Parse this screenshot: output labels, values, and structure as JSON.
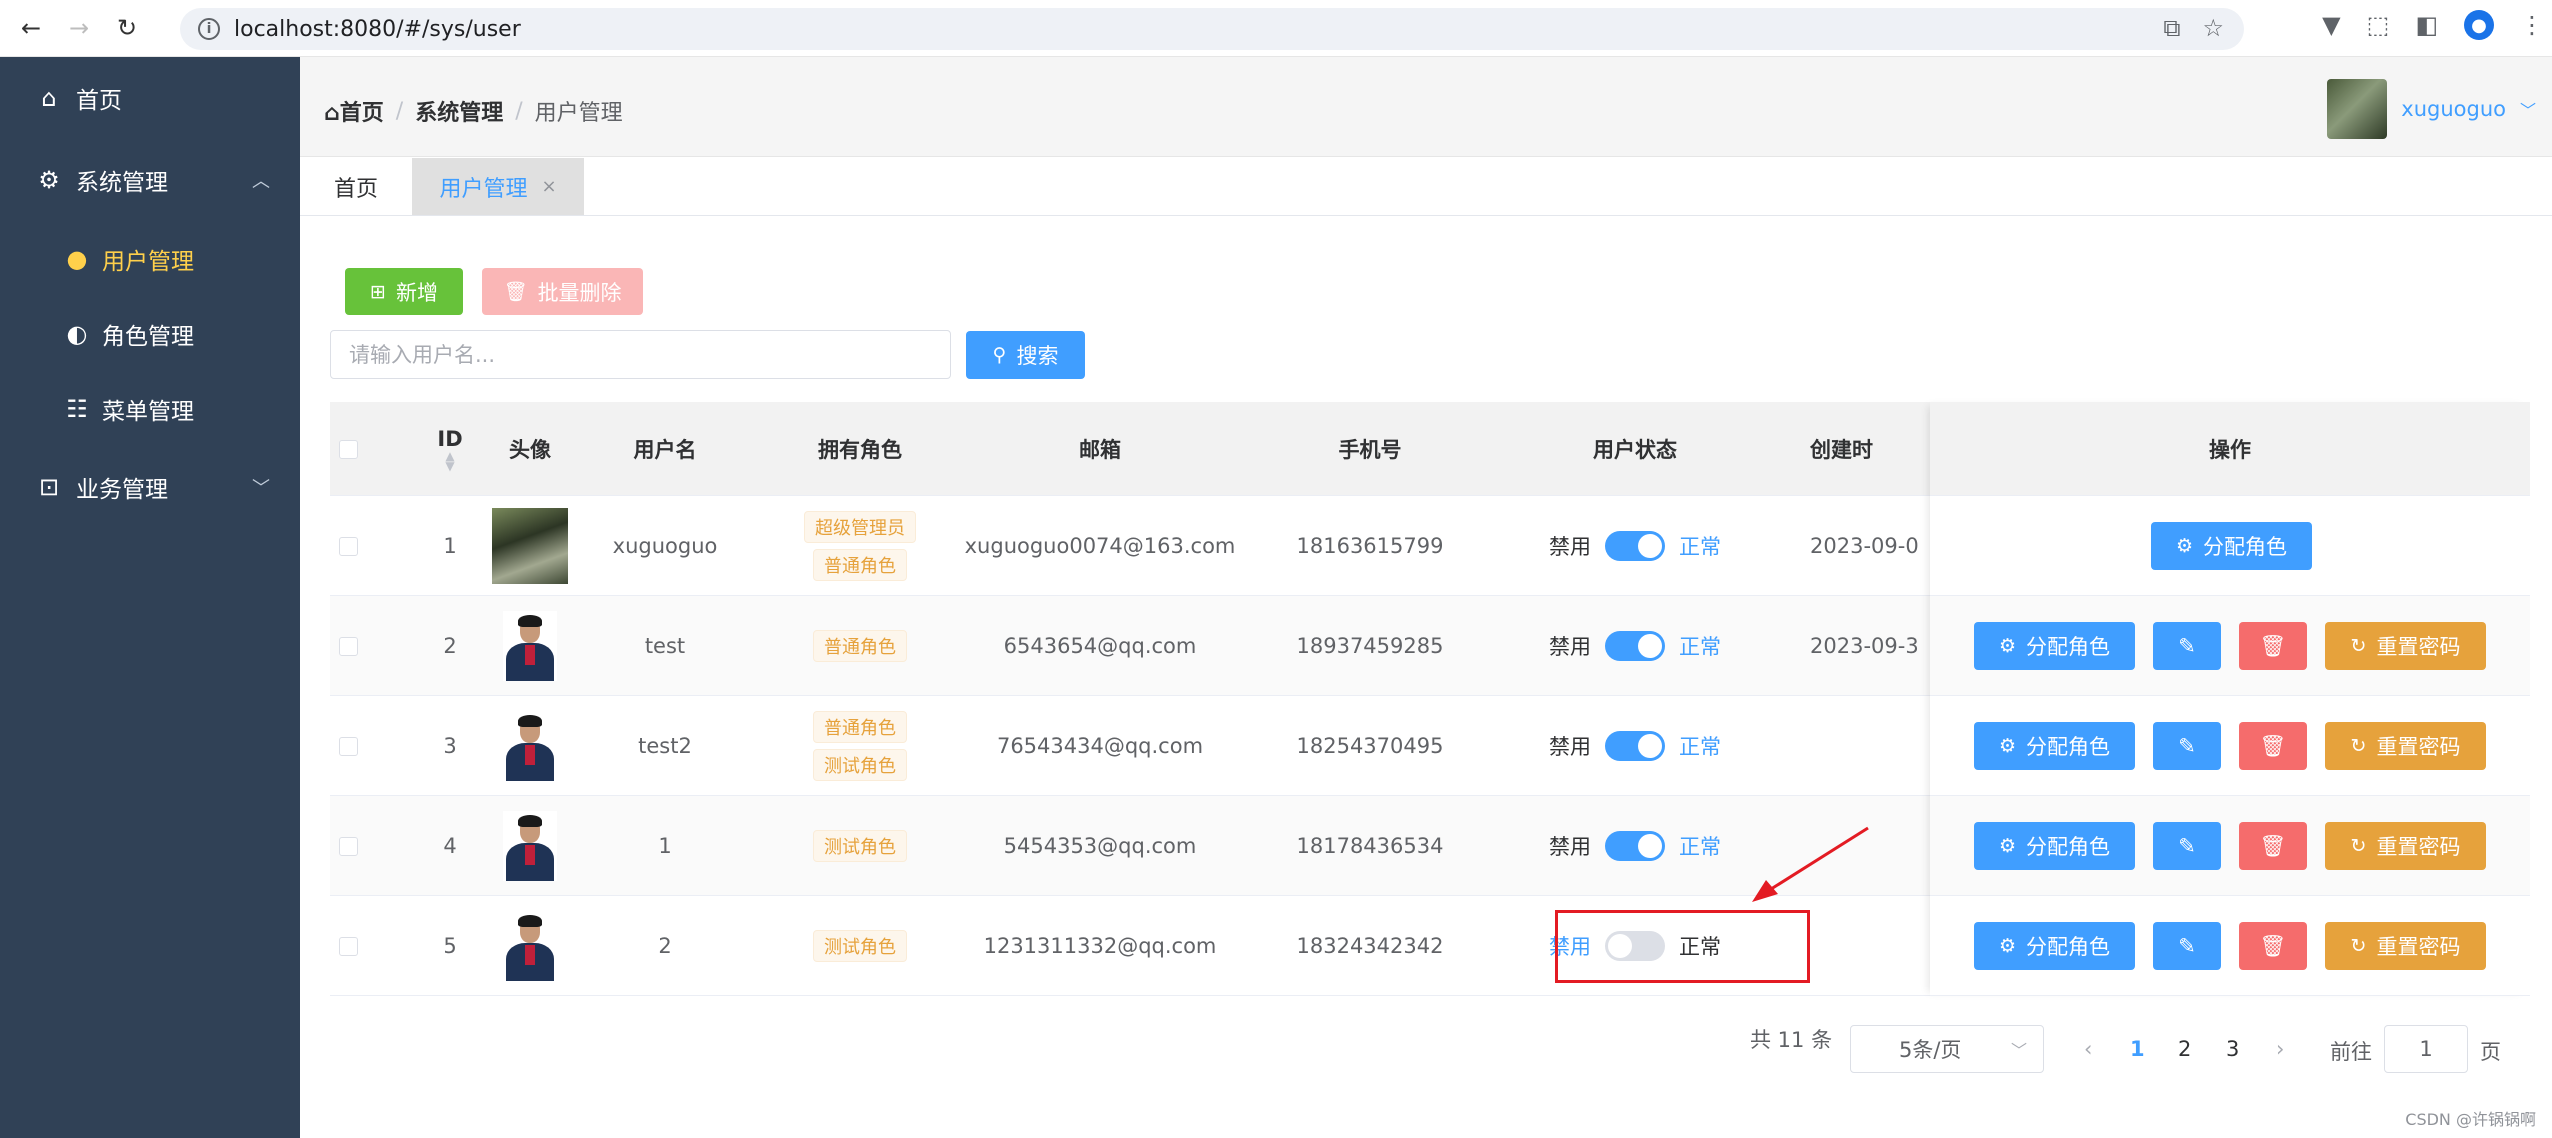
{
  "browser": {
    "url": "localhost:8080/#/sys/user",
    "back": "←",
    "forward": "→",
    "reload": "↻",
    "icons": [
      "open-external-icon",
      "star-icon",
      "extension-icon",
      "sidebar-icon",
      "profile-icon",
      "more-icon"
    ]
  },
  "sidebar": {
    "home": "首页",
    "system": "系统管理",
    "items": [
      {
        "label": "用户管理",
        "icon": "user-icon",
        "active": true
      },
      {
        "label": "角色管理",
        "icon": "users-icon",
        "active": false
      },
      {
        "label": "菜单管理",
        "icon": "tree-icon",
        "active": false
      }
    ],
    "business": "业务管理"
  },
  "header": {
    "breadcrumb": [
      "首页",
      "系统管理",
      "用户管理"
    ],
    "username": "xuguoguo"
  },
  "tabs": [
    {
      "label": "首页"
    },
    {
      "label": "用户管理",
      "close": "×"
    }
  ],
  "toolbar": {
    "add_label": "新增",
    "batch_delete_label": "批量删除",
    "search_placeholder": "请输入用户名...",
    "search_label": "搜索"
  },
  "table": {
    "columns": {
      "id": "ID",
      "avatar": "头像",
      "username": "用户名",
      "roles": "拥有角色",
      "email": "邮箱",
      "phone": "手机号",
      "status": "用户状态",
      "created": "创建时",
      "actions": "操作"
    },
    "status_off": "禁用",
    "status_on": "正常",
    "actions": {
      "assign_role": "分配角色",
      "reset_pwd": "重置密码"
    },
    "rows": [
      {
        "id": "1",
        "username": "xuguoguo",
        "roles": [
          "超级管理员",
          "普通角色"
        ],
        "email": "xuguoguo0074@163.com",
        "phone": "18163615799",
        "enabled": true,
        "created": "2023-09-0"
      },
      {
        "id": "2",
        "username": "test",
        "roles": [
          "普通角色"
        ],
        "email": "6543654@qq.com",
        "phone": "18937459285",
        "enabled": true,
        "created": "2023-09-3"
      },
      {
        "id": "3",
        "username": "test2",
        "roles": [
          "普通角色",
          "测试角色"
        ],
        "email": "76543434@qq.com",
        "phone": "18254370495",
        "enabled": true,
        "created": ""
      },
      {
        "id": "4",
        "username": "1",
        "roles": [
          "测试角色"
        ],
        "email": "5454353@qq.com",
        "phone": "18178436534",
        "enabled": true,
        "created": ""
      },
      {
        "id": "5",
        "username": "2",
        "roles": [
          "测试角色"
        ],
        "email": "1231311332@qq.com",
        "phone": "18324342342",
        "enabled": false,
        "created": ""
      }
    ]
  },
  "pagination": {
    "total": "共 11 条",
    "page_size": "5条/页",
    "pages": [
      "1",
      "2",
      "3"
    ],
    "current": "1",
    "goto_label": "前往",
    "goto_value": "1",
    "page_unit": "页"
  },
  "watermark": "CSDN @许锅锅啊",
  "colors": {
    "primary": "#409eff",
    "success": "#67c23a",
    "danger": "#f56c6c",
    "warning": "#e6a23c",
    "sidebar": "#304156",
    "active_menu": "#ffd04b",
    "annotation": "#e31b23"
  }
}
